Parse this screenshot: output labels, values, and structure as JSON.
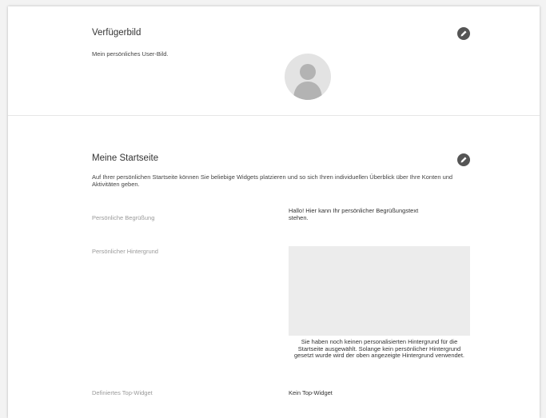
{
  "profile_picture": {
    "title": "Verfügerbild",
    "description": "Mein persönliches User-Bild."
  },
  "start_page": {
    "title": "Meine Startseite",
    "description": "Auf Ihrer persönlichen Startseite können Sie beliebige Widgets platzieren und so sich Ihren individuellen Überblick über Ihre Konten und Aktivitäten geben.",
    "fields": [
      {
        "label": "Persönliche Begrüßung",
        "value": "Hallo! Hier kann Ihr persönlicher Begrüßungstext stehen."
      },
      {
        "label": "Persönlicher Hintergrund",
        "value": "Sie haben noch keinen personalisierten Hintergrund für die Startseite ausgewählt. Solange kein persönlicher Hintergrund gesetzt wurde wird der oben angezeigte Hintergrund verwendet."
      },
      {
        "label": "Definiertes Top-Widget",
        "value": "Kein Top-Widget"
      }
    ]
  },
  "icons": {
    "edit": "pencil-icon",
    "avatar": "user-silhouette-icon"
  }
}
